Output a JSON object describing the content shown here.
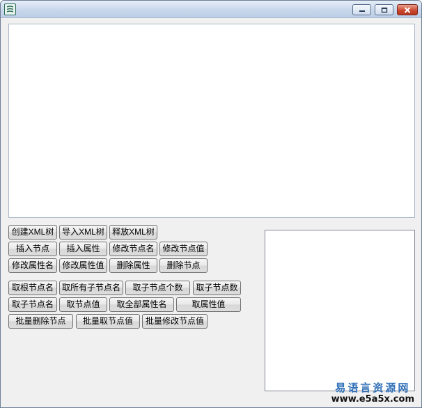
{
  "window": {
    "title": ""
  },
  "titlebar": {
    "minimize_icon": "minimize-icon",
    "maximize_icon": "maximize-icon",
    "close_icon": "close-icon",
    "accent_color": "#c9d8ec",
    "close_color": "#cc4a31"
  },
  "buttons": {
    "create_xml_tree": "创建XML树",
    "import_xml_tree": "导入XML树",
    "release_xml_tree": "释放XML树",
    "insert_node": "插入节点",
    "insert_attribute": "插入属性",
    "modify_node_name": "修改节点名",
    "modify_node_value": "修改节点值",
    "modify_attribute_name": "修改属性名",
    "modify_attribute_value": "修改属性值",
    "delete_attribute": "删除属性",
    "delete_node": "删除节点",
    "get_root_node_name": "取根节点名",
    "get_all_child_node_names": "取所有子节点名",
    "get_child_node_count_1": "取子节点个数",
    "get_child_node_count_2": "取子节点数",
    "get_child_node_name": "取子节点名",
    "get_node_value": "取节点值",
    "get_all_attribute_names": "取全部属性名",
    "get_attribute_value": "取属性值",
    "batch_delete_nodes": "批量删除节点",
    "batch_get_node_values": "批量取节点值",
    "batch_modify_node_values": "批量修改节点值"
  },
  "watermark": {
    "title": "易语言资源网",
    "url": "www.e5a5x.com"
  }
}
